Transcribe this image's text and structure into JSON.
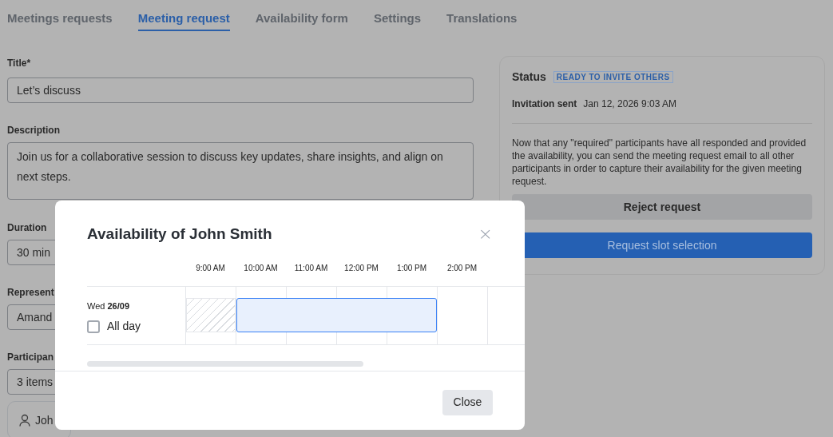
{
  "tabs": [
    {
      "label": "Meetings requests",
      "selected": false
    },
    {
      "label": "Meeting request",
      "selected": true
    },
    {
      "label": "Availability form",
      "selected": false
    },
    {
      "label": "Settings",
      "selected": false
    },
    {
      "label": "Translations",
      "selected": false
    }
  ],
  "form": {
    "title": {
      "label": "Title*",
      "value": "Let’s discuss"
    },
    "description": {
      "label": "Description",
      "value": "Join us for a collaborative session to discuss key updates, share insights, and align on next steps."
    },
    "duration": {
      "label": "Duration",
      "value": "30 min"
    },
    "representative": {
      "label": "Represent",
      "value": "Amand"
    },
    "participants": {
      "label": "Participan",
      "value": "3 items",
      "first_participant": "Joh"
    }
  },
  "status_panel": {
    "title": "Status",
    "badge": "READY TO INVITE OTHERS",
    "invitation_label": "Invitation sent",
    "invitation_date": "Jan 12, 2026 9:03 AM",
    "message": "Now that any \"required\" participants have all responded and provided the availability, you can send the meeting request email to all other participants in order to capture their availability for the given meeting request.",
    "buttons": [
      {
        "label": "Reject request",
        "kind": "secondary"
      },
      {
        "label": "Request slot selection",
        "kind": "primary"
      }
    ]
  },
  "modal": {
    "title": "Availability of John Smith",
    "close_icon": "×",
    "hours": [
      {
        "label": "9:00 AM",
        "kind": "unavailable"
      },
      {
        "label": "10:00 AM",
        "kind": "available"
      },
      {
        "label": "11:00 AM",
        "kind": "available"
      },
      {
        "label": "12:00 PM",
        "kind": "available"
      },
      {
        "label": "1:00 PM",
        "kind": "available"
      },
      {
        "label": "2:00 PM",
        "kind": "empty"
      }
    ],
    "day": {
      "weekday": "Wed",
      "date": "26/09",
      "all_day_label": "All day",
      "all_day": false
    },
    "footer_button": "Close"
  }
}
